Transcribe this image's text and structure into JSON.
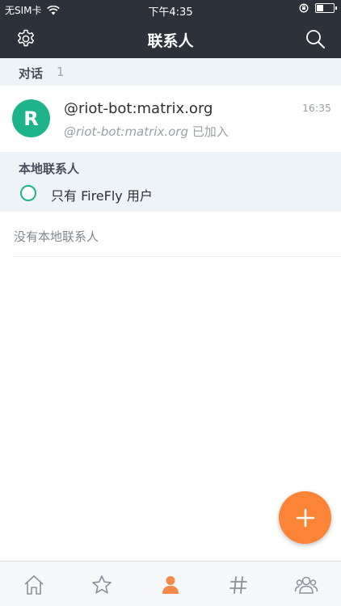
{
  "status_bar": {
    "carrier": "无SIM卡",
    "time": "下午4:35",
    "battery_level": 0.45
  },
  "header": {
    "title": "联系人",
    "settings_icon": "gear-icon",
    "search_icon": "search-icon"
  },
  "conversations": {
    "label": "对话",
    "count": "1",
    "items": [
      {
        "avatar_letter": "R",
        "name": "@riot-bot:matrix.org",
        "time": "16:35",
        "subtitle_id": "@riot-bot:matrix.org",
        "subtitle_suffix": " 已加入"
      }
    ]
  },
  "local_contacts": {
    "label": "本地联系人",
    "filter_label": "只有 FireFly 用户",
    "empty_text": "没有本地联系人"
  },
  "fab": {
    "icon": "plus-icon"
  },
  "tabs": [
    {
      "name": "home",
      "icon": "home-icon",
      "active": false
    },
    {
      "name": "favourites",
      "icon": "star-icon",
      "active": false
    },
    {
      "name": "people",
      "icon": "person-icon",
      "active": true
    },
    {
      "name": "rooms",
      "icon": "hash-icon",
      "active": false
    },
    {
      "name": "groups",
      "icon": "group-icon",
      "active": false
    }
  ],
  "colors": {
    "header_bg": "#2d323a",
    "accent_green": "#1eb38a",
    "fab_orange": "#fb8437",
    "active_tab": "#f5894a",
    "inactive_tab": "#8a9299"
  }
}
